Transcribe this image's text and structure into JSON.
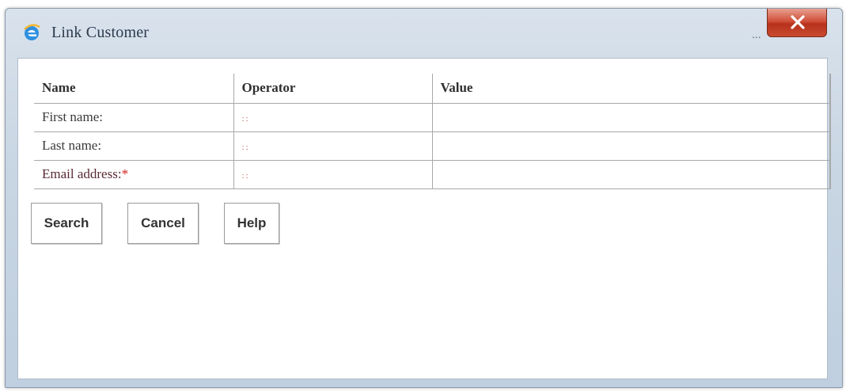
{
  "window": {
    "title": "Link Customer",
    "overflow_indicator": "...",
    "icon": "internet-explorer-icon",
    "close_icon": "close-x-icon",
    "close_color": "#c8412b"
  },
  "table": {
    "headers": [
      "Name",
      "Operator",
      "Value"
    ],
    "rows": [
      {
        "name": "First name:",
        "operator": "::",
        "value": "",
        "required": false
      },
      {
        "name": "Last name:",
        "operator": "::",
        "value": "",
        "required": false
      },
      {
        "name": "Email address:",
        "required_marker": "*",
        "operator": "::",
        "value": "",
        "required": true
      }
    ]
  },
  "buttons": {
    "search": "Search",
    "cancel": "Cancel",
    "help": "Help"
  },
  "colors": {
    "required_marker": "#d02020",
    "operator_glyph": "#c06060"
  }
}
